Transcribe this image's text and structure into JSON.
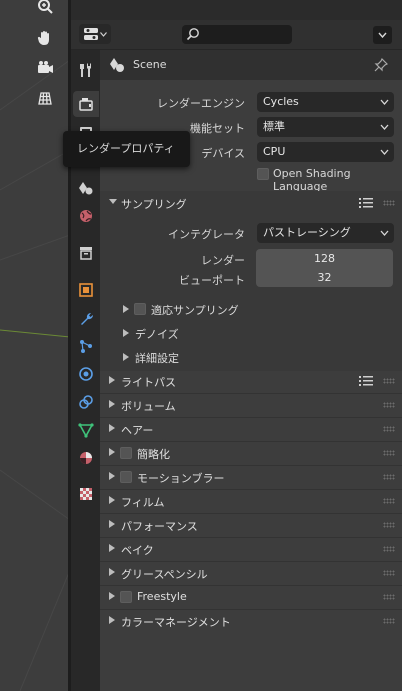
{
  "header": {
    "editor_type_icon": "properties-editor-icon",
    "search_placeholder": "",
    "options_icon": "chevron-down-icon"
  },
  "tabs": [
    {
      "name": "tool",
      "icon": "tool-icon"
    },
    {
      "name": "render",
      "icon": "render-icon",
      "active": true
    },
    {
      "name": "output",
      "icon": "output-icon"
    },
    {
      "name": "view-layer",
      "icon": "view-layer-icon"
    },
    {
      "name": "scene",
      "icon": "scene-icon"
    },
    {
      "name": "world",
      "icon": "world-icon"
    },
    {
      "name": "collection",
      "icon": "collection-icon"
    },
    {
      "name": "object",
      "icon": "object-icon"
    },
    {
      "name": "modifiers",
      "icon": "wrench-icon"
    },
    {
      "name": "particles",
      "icon": "particles-icon"
    },
    {
      "name": "physics",
      "icon": "physics-icon"
    },
    {
      "name": "constraints",
      "icon": "constraints-icon"
    },
    {
      "name": "data",
      "icon": "mesh-data-icon"
    },
    {
      "name": "material",
      "icon": "material-icon"
    },
    {
      "name": "texture",
      "icon": "texture-icon"
    }
  ],
  "context": {
    "label": "Scene"
  },
  "render_settings": {
    "engine_label": "レンダーエンジン",
    "engine_value": "Cycles",
    "feature_set_label": "機能セット",
    "feature_set_value": "標準",
    "device_label": "デバイス",
    "device_value": "CPU",
    "osl_label": "Open Shading Language"
  },
  "sampling": {
    "title": "サンプリング",
    "integrator_label": "インテグレータ",
    "integrator_value": "パストレーシング",
    "render_label": "レンダー",
    "render_value": "128",
    "viewport_label": "ビューポート",
    "viewport_value": "32",
    "adaptive": "適応サンプリング",
    "denoise": "デノイズ",
    "advanced": "詳細設定"
  },
  "panels": {
    "light_paths": "ライトパス",
    "volumes": "ボリューム",
    "hair": "ヘアー",
    "simplify": "簡略化",
    "motion_blur": "モーションブラー",
    "film": "フィルム",
    "performance": "パフォーマンス",
    "bake": "ベイク",
    "grease_pencil": "グリースペンシル",
    "freestyle": "Freestyle",
    "color_management": "カラーマネージメント"
  },
  "tooltip": {
    "text": "レンダープロパティ"
  },
  "colors": {
    "accent_green_line": "#5a7a2a",
    "checkbox_bg": "#545454",
    "field_bg": "#282828"
  }
}
